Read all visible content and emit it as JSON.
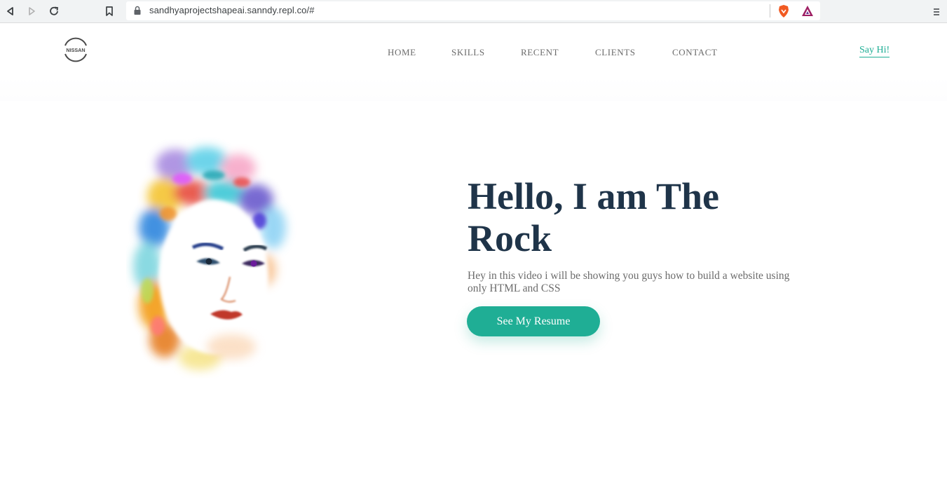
{
  "browser": {
    "url": "sandhyaprojectshapeai.sanndy.repl.co/#",
    "icons": [
      "back-icon",
      "forward-icon",
      "reload-icon",
      "bookmark-icon",
      "lock-icon",
      "brave-shield-icon",
      "brave-rewards-icon",
      "menu-icon"
    ]
  },
  "header": {
    "logo_text": "NISSAN",
    "nav": [
      "HOME",
      "SKILLS",
      "RECENT",
      "CLIENTS",
      "CONTACT"
    ],
    "say_hi": "Say Hi!"
  },
  "hero": {
    "title_line1": "Hello, I am The",
    "title_line2": "Rock",
    "subtitle": "Hey in this video i will be showing you guys how to build a website using only HTML and CSS",
    "cta": "See My Resume"
  },
  "colors": {
    "accent": "#1fae95",
    "heading": "#1f3449",
    "body_text": "#6b6b6b",
    "chrome": "#f1f3f4"
  }
}
